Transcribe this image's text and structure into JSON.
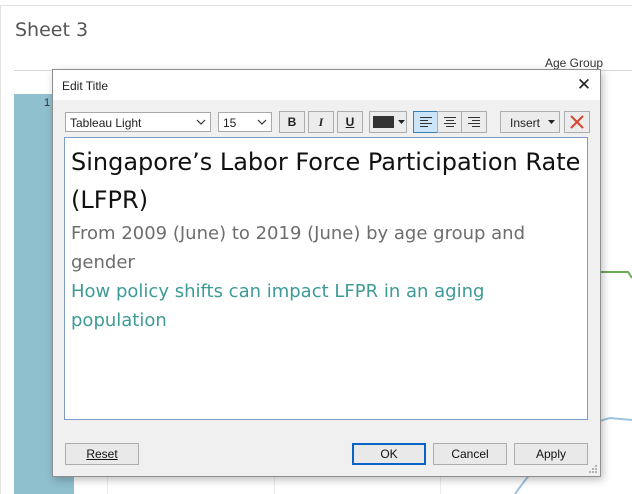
{
  "worksheet": {
    "title": "Sheet 3",
    "column_header": "Age Group",
    "axis_tick": "1",
    "colors": {
      "bar": "#8fc0ce",
      "green_line": "#6aaa5a",
      "blue_line": "#9cc4e0"
    }
  },
  "dialog": {
    "title": "Edit Title",
    "close_icon": "close-icon",
    "toolbar": {
      "font_family": "Tableau Light",
      "font_size": "15",
      "bold_label": "B",
      "italic_label": "I",
      "underline_label": "U",
      "text_color": "#333333",
      "align_left_icon": "align-left-icon",
      "align_center_icon": "align-center-icon",
      "align_right_icon": "align-right-icon",
      "active_alignment": "left",
      "insert_label": "Insert",
      "clear_icon": "clear-formatting-icon"
    },
    "content": {
      "title_text": "Singapore’s Labor Force Participation Rate (LFPR)",
      "subtitle_text": "From 2009 (June) to 2019 (June) by age group and gender",
      "tagline_text": "How policy shifts can impact LFPR in an aging population",
      "colors": {
        "title": "#111111",
        "subtitle": "#6d6d6d",
        "tagline": "#3c9b96"
      }
    },
    "buttons": {
      "reset": "Reset",
      "ok": "OK",
      "cancel": "Cancel",
      "apply": "Apply"
    }
  }
}
